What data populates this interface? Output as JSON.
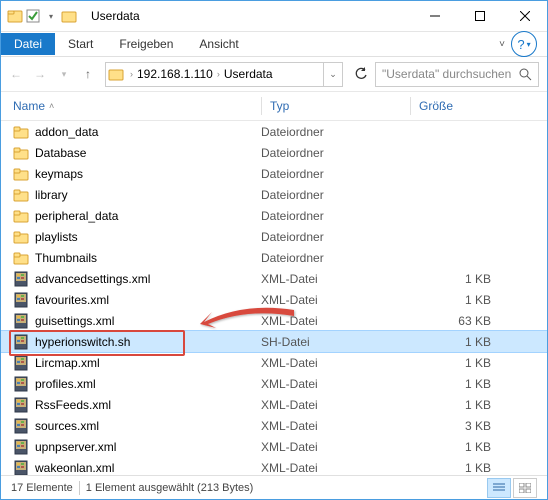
{
  "window": {
    "title": "Userdata"
  },
  "ribbon": {
    "tabs": [
      "Datei",
      "Start",
      "Freigeben",
      "Ansicht"
    ]
  },
  "address": {
    "ip": "192.168.1.110",
    "folder": "Userdata"
  },
  "search": {
    "placeholder": "\"Userdata\" durchsuchen"
  },
  "columns": {
    "name": "Name",
    "type": "Typ",
    "size": "Größe"
  },
  "typeLabels": {
    "folder": "Dateiordner",
    "xml": "XML-Datei",
    "sh": "SH-Datei"
  },
  "files": [
    {
      "n": "addon_data",
      "t": "folder",
      "s": ""
    },
    {
      "n": "Database",
      "t": "folder",
      "s": ""
    },
    {
      "n": "keymaps",
      "t": "folder",
      "s": ""
    },
    {
      "n": "library",
      "t": "folder",
      "s": ""
    },
    {
      "n": "peripheral_data",
      "t": "folder",
      "s": ""
    },
    {
      "n": "playlists",
      "t": "folder",
      "s": ""
    },
    {
      "n": "Thumbnails",
      "t": "folder",
      "s": ""
    },
    {
      "n": "advancedsettings.xml",
      "t": "xml",
      "s": "1 KB"
    },
    {
      "n": "favourites.xml",
      "t": "xml",
      "s": "1 KB"
    },
    {
      "n": "guisettings.xml",
      "t": "xml",
      "s": "63 KB"
    },
    {
      "n": "hyperionswitch.sh",
      "t": "sh",
      "s": "1 KB",
      "sel": true,
      "hl": true
    },
    {
      "n": "Lircmap.xml",
      "t": "xml",
      "s": "1 KB"
    },
    {
      "n": "profiles.xml",
      "t": "xml",
      "s": "1 KB"
    },
    {
      "n": "RssFeeds.xml",
      "t": "xml",
      "s": "1 KB"
    },
    {
      "n": "sources.xml",
      "t": "xml",
      "s": "3 KB"
    },
    {
      "n": "upnpserver.xml",
      "t": "xml",
      "s": "1 KB"
    },
    {
      "n": "wakeonlan.xml",
      "t": "xml",
      "s": "1 KB"
    }
  ],
  "status": {
    "count": "17 Elemente",
    "selected": "1 Element ausgewählt (213 Bytes)"
  }
}
